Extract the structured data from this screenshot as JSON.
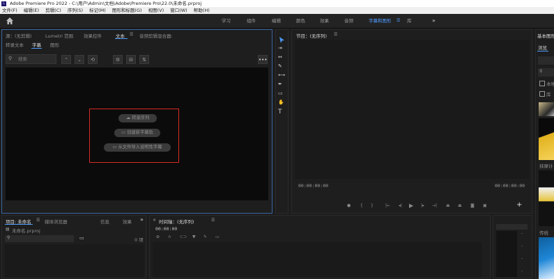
{
  "window": {
    "title": "Adobe Premiere Pro 2022 - C:\\用户\\Admin\\文档\\Adobe\\Premiere Pro\\22.0\\未命名.prproj"
  },
  "menu": [
    "文件(F)",
    "编辑(E)",
    "剪辑(C)",
    "序列(S)",
    "标记(M)",
    "图形和标题(G)",
    "视图(V)",
    "窗口(W)",
    "帮助(H)"
  ],
  "workspaces": {
    "items": [
      "学习",
      "组件",
      "编辑",
      "颜色",
      "效果",
      "音频",
      "字幕和图形",
      "库"
    ],
    "active": "字幕和图形",
    "more": "»"
  },
  "source_panel": {
    "tabs": [
      "源：(无剪辑)",
      "Lumetri 范围",
      "效果控件",
      "文本",
      "音频剪辑混合器:"
    ],
    "active_tab": "文本",
    "subtabs": [
      "转录文本",
      "字幕",
      "图形"
    ],
    "active_subtab": "字幕",
    "search_placeholder": "搜索",
    "actions": [
      "转录序列",
      "创建新字幕轨",
      "从文件导入说明性字幕"
    ],
    "more": "•••"
  },
  "program_monitor": {
    "title": "节目：(无序列)",
    "timecode_left": "00:00:00:00",
    "timecode_right": "00:00:00:00"
  },
  "project_panel": {
    "tabs": [
      "项目: 未命名",
      "媒体浏览器",
      "信息",
      "效果"
    ],
    "more": "»",
    "file": "未命名.prproj",
    "count": "0 项"
  },
  "timeline": {
    "title": "时间轴：(无序列)",
    "timecode": "00:00:00"
  },
  "right_panel": {
    "title": "基本图形",
    "tab": "浏览",
    "checkboxes": [
      "本地",
      "库"
    ],
    "labels": [
      "抹摩计",
      "传统"
    ]
  },
  "colors": {
    "accent": "#4f9cff",
    "highlight_box": "#d62b24"
  }
}
